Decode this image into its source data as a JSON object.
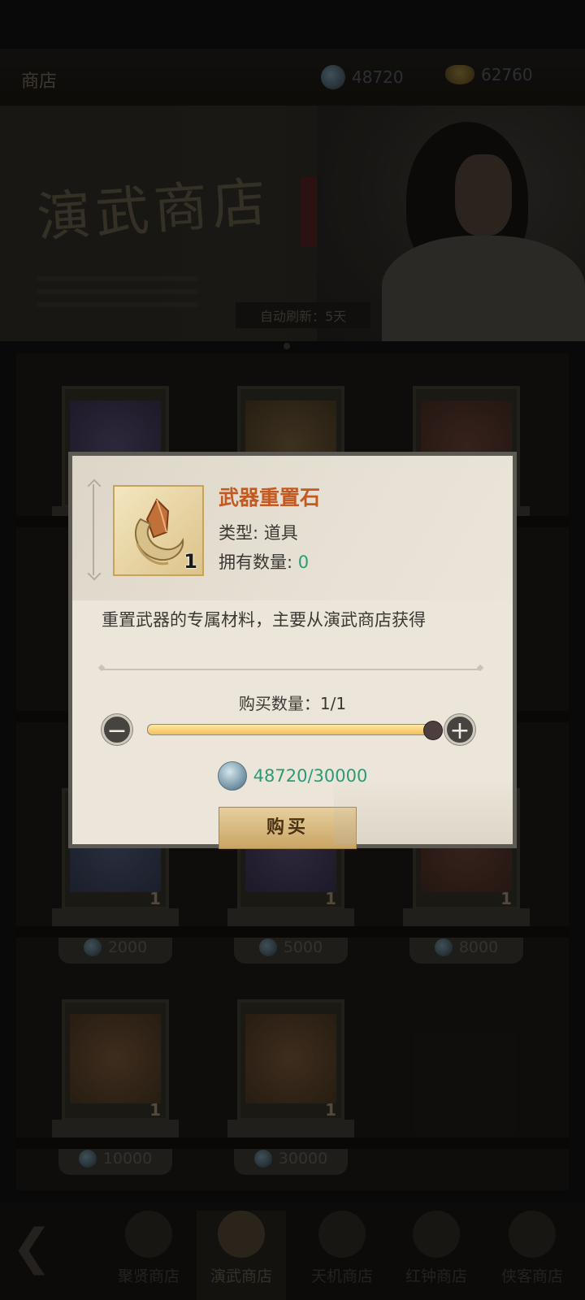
{
  "header": {
    "title": "商店",
    "currency1": "48720",
    "currency2": "62760"
  },
  "banner": {
    "title": "演武商店",
    "refresh_label": "自动刷新：5天"
  },
  "grid": {
    "row2": [
      {
        "count": "1",
        "price": "2000"
      },
      {
        "count": "1",
        "price": "5000"
      },
      {
        "count": "1",
        "price": "8000"
      }
    ],
    "row3": [
      {
        "count": "1",
        "price": "10000"
      },
      {
        "count": "1",
        "price": "30000"
      }
    ]
  },
  "nav": {
    "tabs": [
      {
        "label": "聚贤商店"
      },
      {
        "label": "演武商店"
      },
      {
        "label": "天机商店"
      },
      {
        "label": "红钟商店"
      },
      {
        "label": "侠客商店"
      }
    ]
  },
  "dialog": {
    "item_name": "武器重置石",
    "item_count": "1",
    "type_text": "类型: 道具",
    "owned_label": "拥有数量: ",
    "owned_value": "0",
    "description": "重置武器的专属材料，主要从演武商店获得",
    "quantity_label": "购买数量：1/1",
    "quantity_fraction": 1.0,
    "price_text": "48720/30000",
    "buy_label": "购买",
    "accent_color": "#c25a22",
    "price_color": "#2b9a77"
  }
}
